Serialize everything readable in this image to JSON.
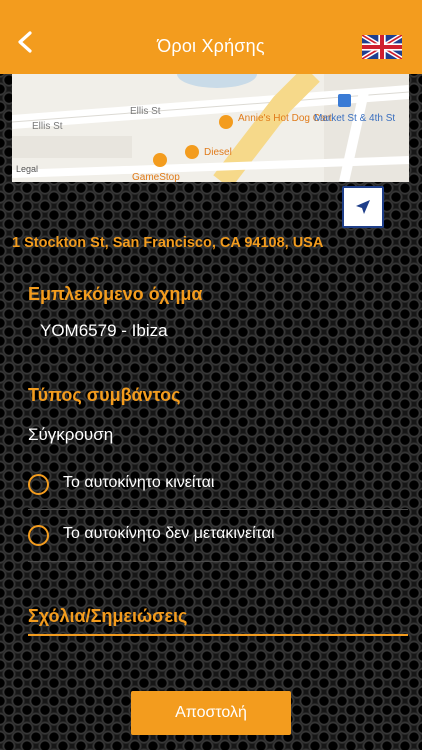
{
  "header": {
    "title": "Όροι Χρήσης",
    "back_icon": "chevron-left-icon",
    "language_icon": "uk-flag-icon",
    "color": "#f39c1e"
  },
  "map": {
    "street_labels": [
      "Ellis St",
      "Ellis St"
    ],
    "places": [
      "Annie's Hot Dog Cart",
      "Diesel",
      "GameStop",
      "Market St & 4th St"
    ],
    "legal_label": "Legal"
  },
  "location": {
    "address": "1 Stockton St, San Francisco, CA 94108, USA"
  },
  "vehicle_section": {
    "title": "Εμπλεκόμενο όχημα",
    "value": "YOM6579 - Ibiza"
  },
  "incident_section": {
    "title": "Τύπος συμβάντος",
    "value": "Σύγκρουση",
    "options": [
      "Το αυτοκίνητο κινείται",
      "Το αυτοκίνητο δεν μετακινείται"
    ]
  },
  "notes": {
    "label": "Σχόλια/Σημειώσεις"
  },
  "actions": {
    "submit_label": "Αποστολή"
  },
  "colors": {
    "accent": "#f39c1e",
    "background": "#161616",
    "text": "#ffffff"
  }
}
